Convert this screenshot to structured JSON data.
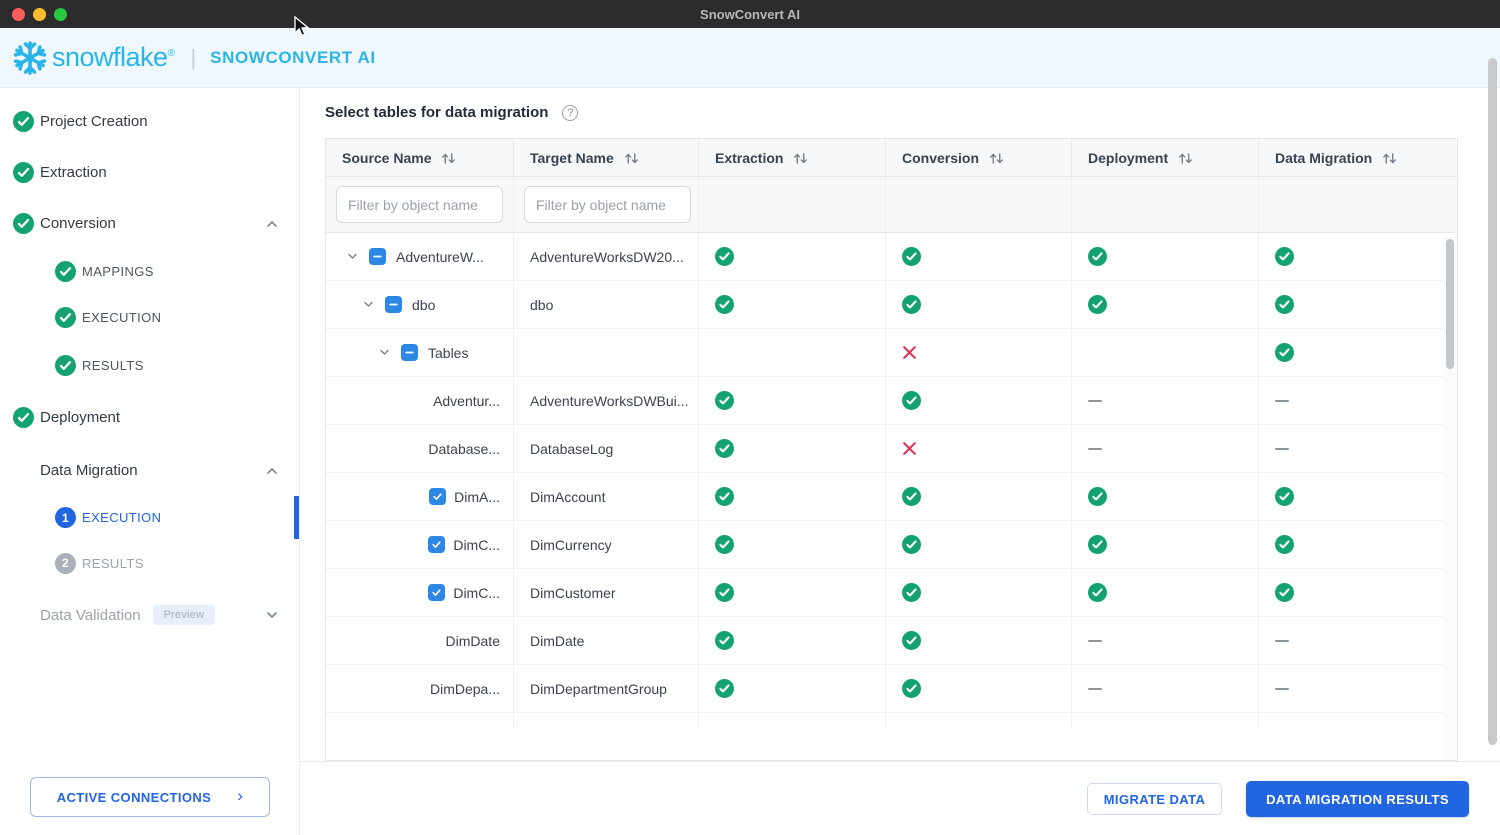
{
  "window": {
    "title": "SnowConvert AI"
  },
  "brand": {
    "logo": "snowflake-logo",
    "wordmark": "snowflake",
    "registered": "®",
    "divider": "|",
    "app_name": "SNOWCONVERT AI"
  },
  "colors": {
    "accent_blue": "#2265e0",
    "brand_blue": "#29b5e8",
    "green": "#15a273",
    "red": "#dc3550",
    "checkbox_blue": "#2d87e4",
    "gray_icon": "#6e7884"
  },
  "sidebar": {
    "items": [
      {
        "label": "Project Creation",
        "status": "done"
      },
      {
        "label": "Extraction",
        "status": "done"
      },
      {
        "label": "Conversion",
        "status": "done",
        "expand": "up",
        "children": [
          {
            "label": "MAPPINGS",
            "status": "done"
          },
          {
            "label": "EXECUTION",
            "status": "done"
          },
          {
            "label": "RESULTS",
            "status": "done"
          }
        ]
      },
      {
        "label": "Deployment",
        "status": "done"
      },
      {
        "label": "Data Migration",
        "expand": "up",
        "children": [
          {
            "label": "EXECUTION",
            "number": "1",
            "state": "active"
          },
          {
            "label": "RESULTS",
            "number": "2",
            "state": "disabled"
          }
        ]
      },
      {
        "label": "Data Validation",
        "state": "disabled",
        "badge": "Preview",
        "expand": "down"
      }
    ],
    "active_connections": {
      "label": "ACTIVE CONNECTIONS",
      "arrow": "›"
    }
  },
  "main": {
    "title": "Select tables for data migration",
    "help": "?",
    "table": {
      "columns": [
        {
          "label": "Source Name",
          "sortable": true
        },
        {
          "label": "Target Name",
          "sortable": true
        },
        {
          "label": "Extraction",
          "sortable": true
        },
        {
          "label": "Conversion",
          "sortable": true
        },
        {
          "label": "Deployment",
          "sortable": true
        },
        {
          "label": "Data Migration",
          "sortable": true
        }
      ],
      "filter_placeholder": "Filter by object name",
      "rows": [
        {
          "source": "AdventureW...",
          "target": "AdventureWorksDW20...",
          "level": 0,
          "expander": true,
          "checkbox": "indeterminate",
          "statuses": [
            "check",
            "check",
            "check",
            "check"
          ]
        },
        {
          "source": "dbo",
          "target": "dbo",
          "level": 1,
          "expander": true,
          "checkbox": "indeterminate",
          "statuses": [
            "check",
            "check",
            "check",
            "check"
          ]
        },
        {
          "source": "Tables",
          "target": "",
          "level": 2,
          "expander": true,
          "checkbox": "indeterminate",
          "statuses": [
            "none",
            "cross",
            "none",
            "check"
          ]
        },
        {
          "source": "Adventur...",
          "target": "AdventureWorksDWBui...",
          "leaf": true,
          "checkbox": "none",
          "statuses": [
            "check",
            "check",
            "dash",
            "dash"
          ]
        },
        {
          "source": "Database...",
          "target": "DatabaseLog",
          "leaf": true,
          "checkbox": "none",
          "statuses": [
            "check",
            "cross",
            "dash",
            "dash"
          ]
        },
        {
          "source": "DimA...",
          "target": "DimAccount",
          "leaf": true,
          "checkbox": "checked",
          "statuses": [
            "check",
            "check",
            "check",
            "check"
          ]
        },
        {
          "source": "DimC...",
          "target": "DimCurrency",
          "leaf": true,
          "checkbox": "checked",
          "statuses": [
            "check",
            "check",
            "check",
            "check"
          ]
        },
        {
          "source": "DimC...",
          "target": "DimCustomer",
          "leaf": true,
          "checkbox": "checked",
          "statuses": [
            "check",
            "check",
            "check",
            "check"
          ]
        },
        {
          "source": "DimDate",
          "target": "DimDate",
          "leaf": true,
          "checkbox": "none",
          "statuses": [
            "check",
            "check",
            "dash",
            "dash"
          ]
        },
        {
          "source": "DimDepa...",
          "target": "DimDepartmentGroup",
          "leaf": true,
          "checkbox": "none",
          "statuses": [
            "check",
            "check",
            "dash",
            "dash"
          ]
        }
      ]
    },
    "footer": {
      "migrate_label": "MIGRATE DATA",
      "results_label": "DATA MIGRATION RESULTS"
    }
  }
}
